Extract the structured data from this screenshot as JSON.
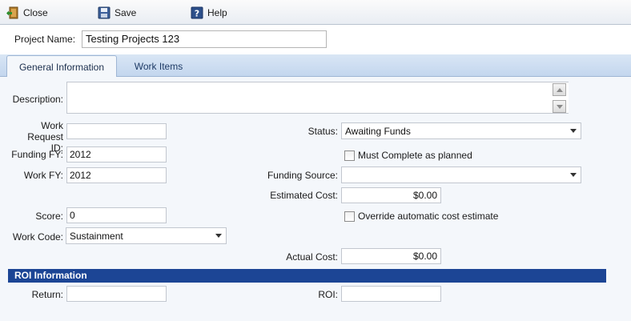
{
  "toolbar": {
    "close_label": "Close",
    "save_label": "Save",
    "help_label": "Help"
  },
  "project": {
    "label": "Project Name:",
    "value": "Testing Projects 123"
  },
  "tabs": [
    {
      "label": "General Information",
      "active": true
    },
    {
      "label": "Work Items",
      "active": false
    }
  ],
  "form": {
    "description_label": "Description:",
    "description_value": "",
    "work_request_label": "Work Request ID:",
    "work_request_value": "",
    "funding_fy_label": "Funding FY:",
    "funding_fy_value": "2012",
    "work_fy_label": "Work FY:",
    "work_fy_value": "2012",
    "score_label": "Score:",
    "score_value": "0",
    "work_code_label": "Work Code:",
    "work_code_value": "Sustainment",
    "status_label": "Status:",
    "status_value": "Awaiting Funds",
    "must_complete_label": "Must Complete as planned",
    "funding_source_label": "Funding Source:",
    "funding_source_value": "",
    "estimated_cost_label": "Estimated Cost:",
    "estimated_cost_value": "$0.00",
    "override_label": "Override automatic cost estimate",
    "actual_cost_label": "Actual Cost:",
    "actual_cost_value": "$0.00"
  },
  "roi": {
    "header": "ROI Information",
    "return_label": "Return:",
    "return_value": "",
    "roi_label": "ROI:",
    "roi_value": ""
  },
  "colors": {
    "section_bar": "#1c4595",
    "tab_strip": "#c3d6ee",
    "panel_bg": "#f4f7fb"
  }
}
